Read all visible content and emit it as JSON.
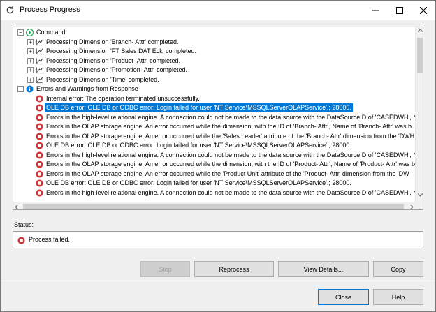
{
  "window": {
    "title": "Process Progress",
    "icon": "refresh-icon",
    "controls": [
      "minimize-icon",
      "maximize-icon",
      "close-icon"
    ]
  },
  "tree": {
    "command_group": {
      "label": "Command",
      "expander": "⊟",
      "icon": "play-circle-icon",
      "items": [
        {
          "label": "Processing Dimension 'Branch- Attr' completed.",
          "expander": "⊞",
          "icon": "processing-icon"
        },
        {
          "label": "Processing Dimension 'FT Sales DAT Eck' completed.",
          "expander": "⊞",
          "icon": "processing-icon"
        },
        {
          "label": "Processing Dimension 'Product- Attr' completed.",
          "expander": "⊞",
          "icon": "processing-icon"
        },
        {
          "label": "Processing Dimension 'Promotion- Attr' completed.",
          "expander": "⊞",
          "icon": "processing-icon"
        },
        {
          "label": "Processing Dimension 'Time' completed.",
          "expander": "⊞",
          "icon": "processing-icon"
        }
      ]
    },
    "errors_group": {
      "label": "Errors and Warnings from Response",
      "expander": "⊟",
      "icon": "info-icon",
      "items": [
        {
          "label": "Internal error: The operation terminated unsuccessfully.",
          "icon": "error-icon",
          "selected": false
        },
        {
          "label": "OLE DB error: OLE DB or ODBC error: Login failed for user 'NT Service\\MSSQLServerOLAPService'.; 28000.",
          "icon": "error-icon",
          "selected": true
        },
        {
          "label": "Errors in the high-level relational engine. A connection could not be made to the data source with the DataSourceID of 'CASEDWH', N",
          "icon": "error-icon",
          "selected": false
        },
        {
          "label": "Errors in the OLAP storage engine: An error occurred while the dimension, with the ID of 'Branch- Attr', Name of 'Branch- Attr' was b",
          "icon": "error-icon",
          "selected": false
        },
        {
          "label": "Errors in the OLAP storage engine: An error occurred while the 'Sales Leader' attribute of the 'Branch- Attr' dimension from the 'DWH",
          "icon": "error-icon",
          "selected": false
        },
        {
          "label": "OLE DB error: OLE DB or ODBC error: Login failed for user 'NT Service\\MSSQLServerOLAPService'.; 28000.",
          "icon": "error-icon",
          "selected": false
        },
        {
          "label": "Errors in the high-level relational engine. A connection could not be made to the data source with the DataSourceID of 'CASEDWH', N",
          "icon": "error-icon",
          "selected": false
        },
        {
          "label": "Errors in the OLAP storage engine: An error occurred while the dimension, with the ID of 'Product- Attr', Name of 'Product- Attr' was b",
          "icon": "error-icon",
          "selected": false
        },
        {
          "label": "Errors in the OLAP storage engine: An error occurred while the 'Product Unit' attribute of the 'Product- Attr' dimension from the 'DW",
          "icon": "error-icon",
          "selected": false
        },
        {
          "label": "OLE DB error: OLE DB or ODBC error: Login failed for user 'NT Service\\MSSQLServerOLAPService'.; 28000.",
          "icon": "error-icon",
          "selected": false
        },
        {
          "label": "Errors in the high-level relational engine. A connection could not be made to the data source with the DataSourceID of 'CASEDWH', N",
          "icon": "error-icon",
          "selected": false
        }
      ]
    }
  },
  "status": {
    "label": "Status:",
    "icon": "error-icon",
    "text": "Process failed."
  },
  "buttons": {
    "stop": "Stop",
    "reprocess": "Reprocess",
    "view_details": "View Details...",
    "copy": "Copy",
    "close": "Close",
    "help": "Help"
  },
  "colors": {
    "selection": "#0078d7",
    "error": "#d13438",
    "success": "#16a34a",
    "info": "#0078d7"
  }
}
